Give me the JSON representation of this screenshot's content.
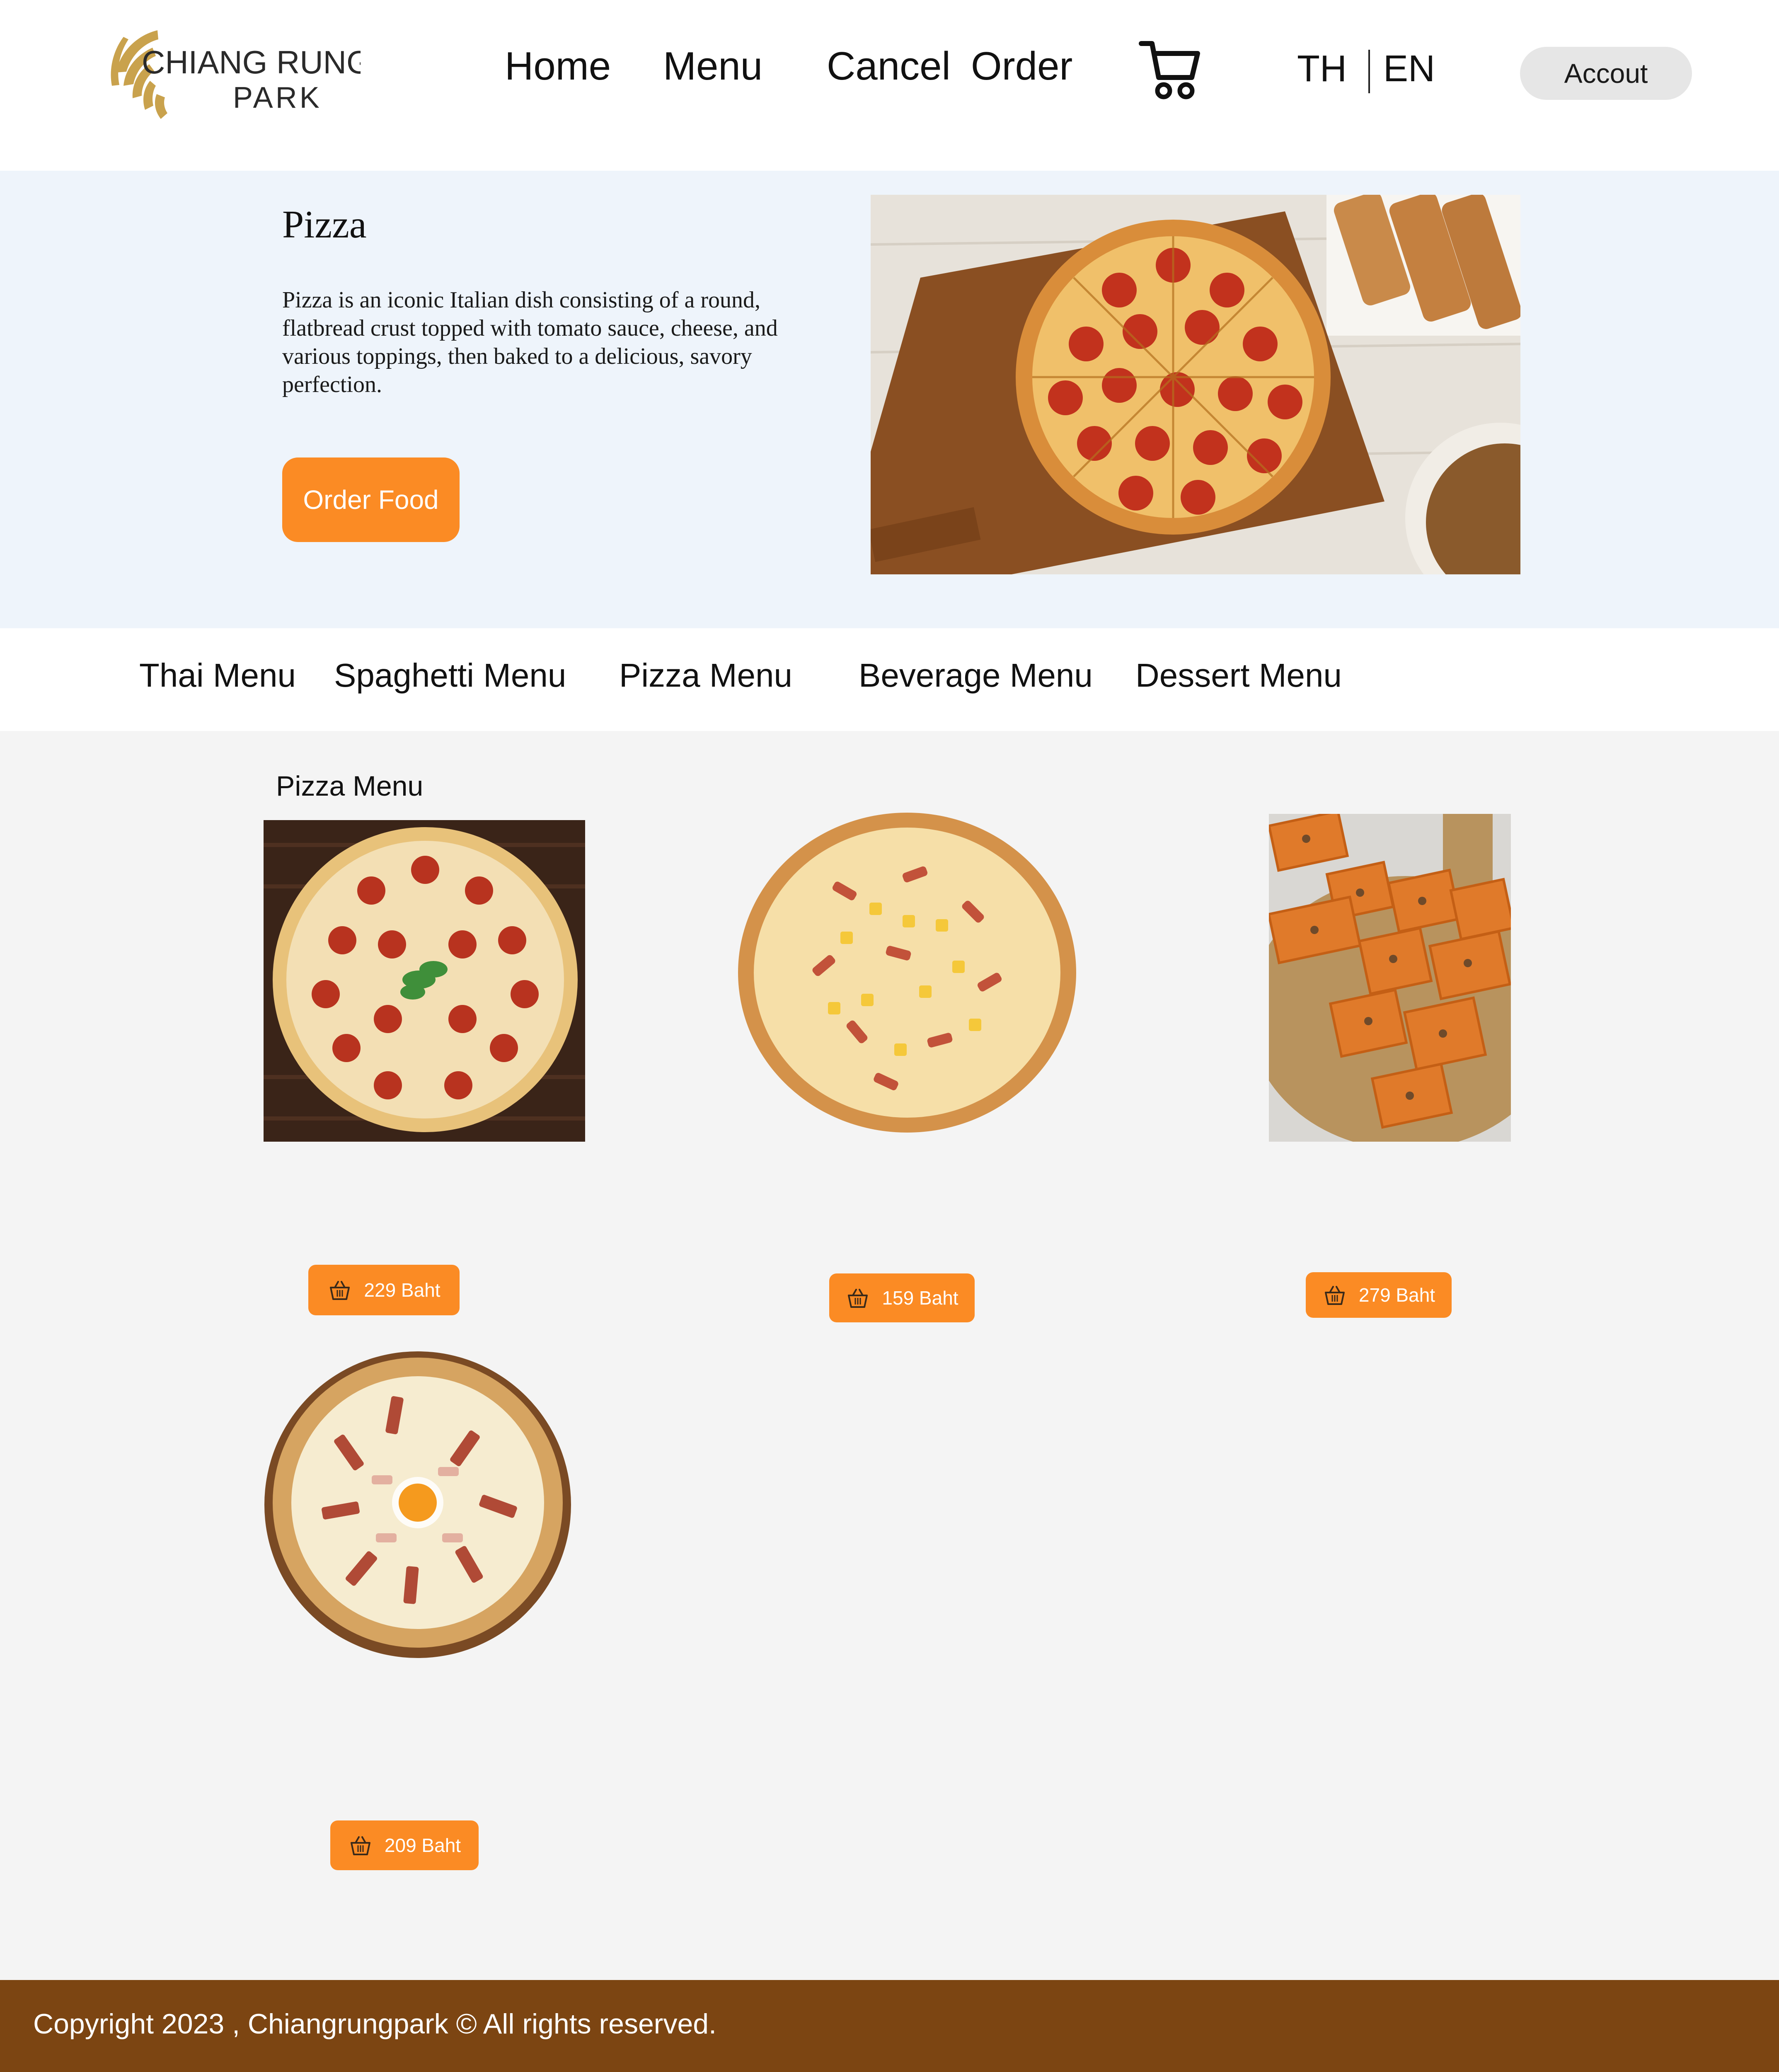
{
  "header": {
    "logo": {
      "line1": "CHIANG RUNG",
      "line2": "PARK"
    },
    "nav": [
      {
        "label": "Home"
      },
      {
        "label": "Menu"
      },
      {
        "label": "Cancel"
      },
      {
        "label": "Order"
      }
    ],
    "cart_icon": "cart-icon",
    "lang": {
      "th": "TH",
      "en": "EN"
    },
    "account_label": "Accout"
  },
  "hero": {
    "title": "Pizza",
    "description": "Pizza is an iconic Italian dish consisting of a round, flatbread crust topped with tomato sauce, cheese, and various toppings, then baked to a delicious, savory perfection.",
    "order_button": "Order Food"
  },
  "categories": [
    {
      "label": "Thai Menu"
    },
    {
      "label": "Spaghetti Menu"
    },
    {
      "label": "Pizza Menu"
    },
    {
      "label": "Beverage Menu"
    },
    {
      "label": "Dessert Menu"
    }
  ],
  "menu": {
    "section_title": "Pizza Menu",
    "items": [
      {
        "price": "229 Baht"
      },
      {
        "price": "159 Baht"
      },
      {
        "price": "279 Baht"
      },
      {
        "price": "209 Baht"
      }
    ],
    "basket_icon": "basket-icon"
  },
  "footer": {
    "copyright": "Copyright 2023 , Chiangrungpark © All rights reserved."
  },
  "colors": {
    "accent": "#fb8b24",
    "hero_bg": "#eef4fb",
    "menu_bg": "#f4f4f4",
    "footer_bg": "#7c4512",
    "logo_gold": "#c9a24d"
  }
}
